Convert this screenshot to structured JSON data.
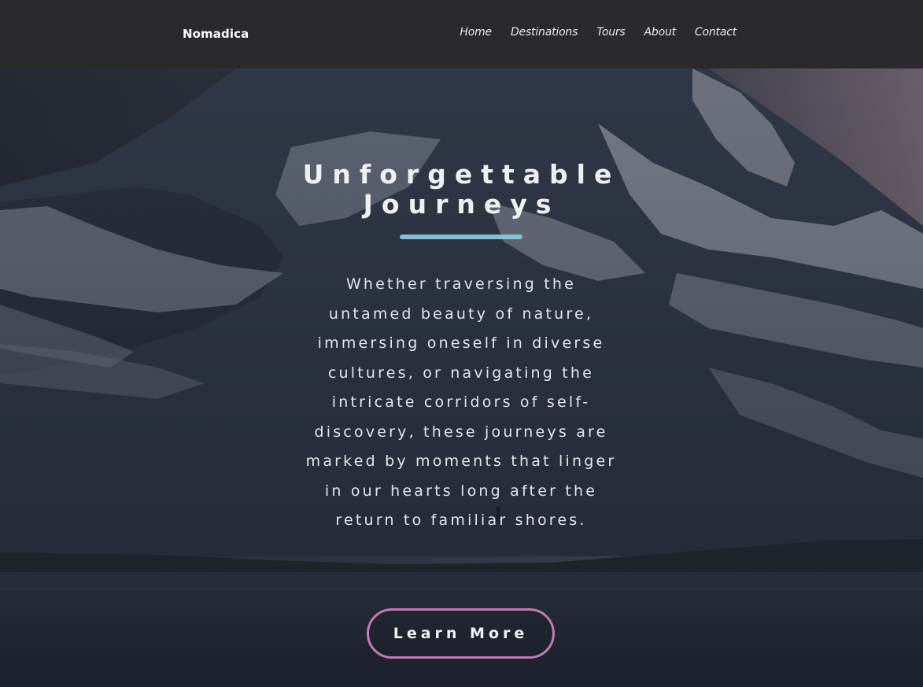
{
  "header": {
    "brand": "Nomadica",
    "nav": [
      "Home",
      "Destinations",
      "Tours",
      "About",
      "Contact"
    ]
  },
  "hero": {
    "title_lines": [
      "Unforgettable",
      "Journeys"
    ],
    "body": "Whether traversing the untamed beauty of nature, immersing oneself in diverse cultures, or navigating the intricate corridors of self-discovery, these journeys are marked by moments that linger in our hearts long after the return to familiar shores.",
    "cta_label": "Learn More"
  },
  "colors": {
    "header_bg": "#2a2a2d",
    "accent_divider": "#7fc4d4",
    "cta_border": "#c27bb3",
    "text": "#eef0f4"
  }
}
